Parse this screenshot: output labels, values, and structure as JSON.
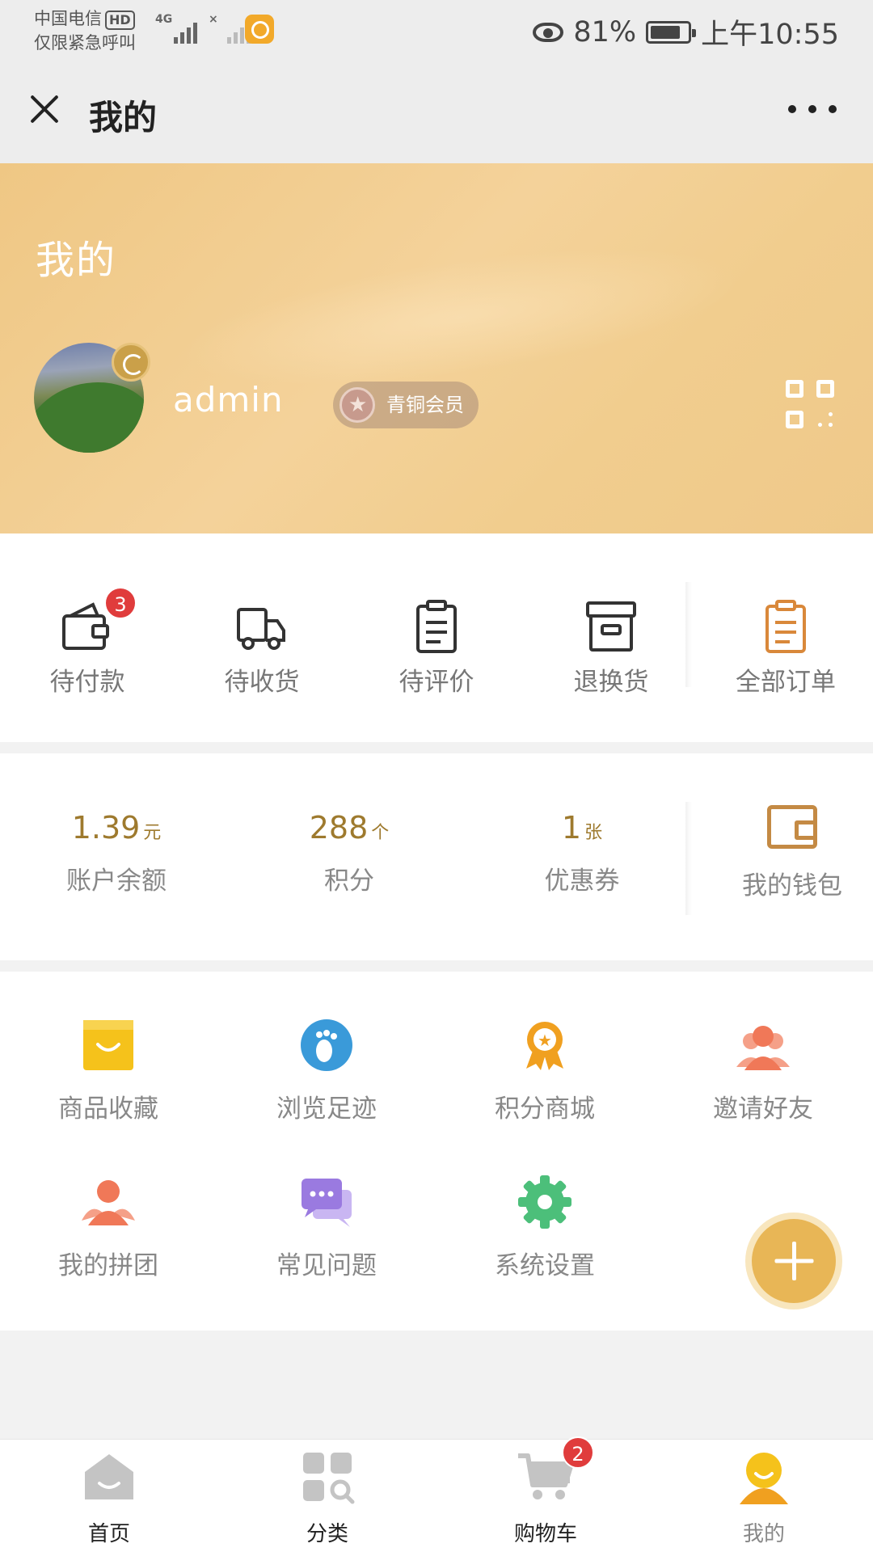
{
  "status_bar": {
    "carrier": "中国电信",
    "hd": "HD",
    "emergency_text": "仅限紧急呼叫",
    "network_tag": "4G",
    "second_tag": "×",
    "battery": "81%",
    "battery_level": 0.81,
    "time": "上午10:55"
  },
  "header": {
    "title": "我的"
  },
  "profile": {
    "banner_title": "我的",
    "username": "admin",
    "member_level": "青铜会员"
  },
  "orders": [
    {
      "label": "待付款",
      "icon": "wallet-icon",
      "badge": "3"
    },
    {
      "label": "待收货",
      "icon": "truck-icon",
      "badge": ""
    },
    {
      "label": "待评价",
      "icon": "clipboard-icon",
      "badge": ""
    },
    {
      "label": "退换货",
      "icon": "archive-box-icon",
      "badge": ""
    },
    {
      "label": "全部订单",
      "icon": "orders-list-icon",
      "badge": ""
    }
  ],
  "wallet": {
    "stats": [
      {
        "value": "1.39",
        "unit": "元",
        "label": "账户余额"
      },
      {
        "value": "288",
        "unit": "个",
        "label": "积分"
      },
      {
        "value": "1",
        "unit": "张",
        "label": "优惠券"
      }
    ],
    "link_label": "我的钱包"
  },
  "services": [
    {
      "label": "商品收藏",
      "icon": "favorites-bag-icon",
      "color": "#f5c21b"
    },
    {
      "label": "浏览足迹",
      "icon": "footprint-icon",
      "color": "#3a9ad9"
    },
    {
      "label": "积分商城",
      "icon": "medal-icon",
      "color": "#f0a020"
    },
    {
      "label": "邀请好友",
      "icon": "friends-icon",
      "color": "#f07858"
    },
    {
      "label": "我的拼团",
      "icon": "group-buy-icon",
      "color": "#f07858"
    },
    {
      "label": "常见问题",
      "icon": "faq-chat-icon",
      "color": "#9a7ae0"
    },
    {
      "label": "系统设置",
      "icon": "settings-gear-icon",
      "color": "#4cbf7a"
    }
  ],
  "tabbar": [
    {
      "label": "首页",
      "icon": "home-icon",
      "badge": ""
    },
    {
      "label": "分类",
      "icon": "category-icon",
      "badge": ""
    },
    {
      "label": "购物车",
      "icon": "cart-icon",
      "badge": "2"
    },
    {
      "label": "我的",
      "icon": "profile-icon",
      "badge": ""
    }
  ],
  "colors": {
    "accent": "#e8b656",
    "badge": "#e03c3c",
    "value_text": "#9e7a2e"
  }
}
